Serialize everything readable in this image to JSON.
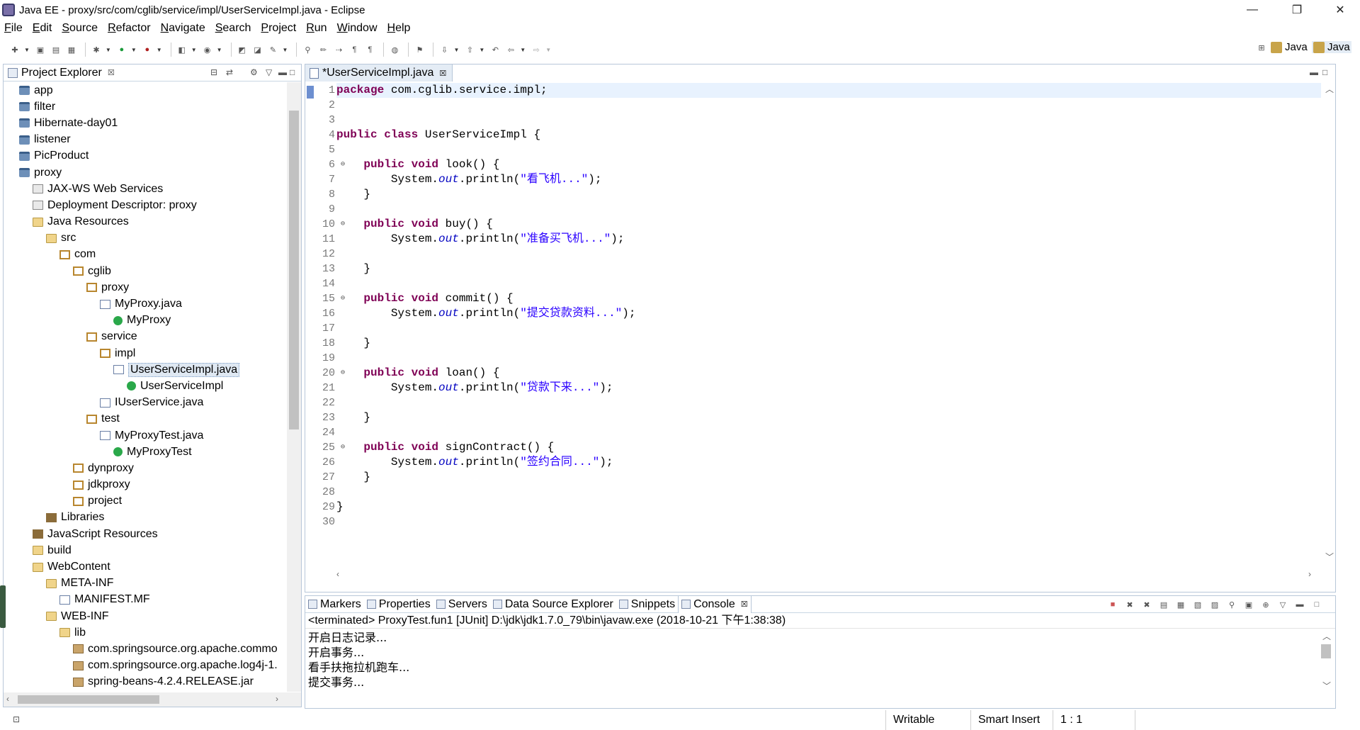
{
  "window": {
    "title": "Java EE - proxy/src/com/cglib/service/impl/UserServiceImpl.java - Eclipse",
    "minimize": "—",
    "restore": "❐",
    "close": "✕"
  },
  "menu": [
    "File",
    "Edit",
    "Source",
    "Refactor",
    "Navigate",
    "Search",
    "Project",
    "Run",
    "Window",
    "Help"
  ],
  "perspectives": [
    "Java",
    "Java"
  ],
  "explorer": {
    "tab_label": "Project Explorer",
    "close_glyph": "☒",
    "tree": [
      {
        "label": "app",
        "icon": "proj",
        "depth": 0
      },
      {
        "label": "filter",
        "icon": "proj",
        "depth": 0
      },
      {
        "label": "Hibernate-day01",
        "icon": "proj",
        "depth": 0
      },
      {
        "label": "listener",
        "icon": "proj",
        "depth": 0
      },
      {
        "label": "PicProduct",
        "icon": "proj",
        "depth": 0
      },
      {
        "label": "proxy",
        "icon": "proj",
        "depth": 0
      },
      {
        "label": "JAX-WS Web Services",
        "icon": "ws",
        "depth": 1
      },
      {
        "label": "Deployment Descriptor: proxy",
        "icon": "ws",
        "depth": 1
      },
      {
        "label": "Java Resources",
        "icon": "folder",
        "depth": 1
      },
      {
        "label": "src",
        "icon": "folder",
        "depth": 2
      },
      {
        "label": "com",
        "icon": "pkg",
        "depth": 3
      },
      {
        "label": "cglib",
        "icon": "pkg",
        "depth": 4
      },
      {
        "label": "proxy",
        "icon": "pkg",
        "depth": 5
      },
      {
        "label": "MyProxy.java",
        "icon": "java",
        "depth": 6
      },
      {
        "label": "MyProxy",
        "icon": "class",
        "depth": 7
      },
      {
        "label": "service",
        "icon": "pkg",
        "depth": 5
      },
      {
        "label": "impl",
        "icon": "pkg",
        "depth": 6
      },
      {
        "label": "UserServiceImpl.java",
        "icon": "java",
        "depth": 7,
        "selected": true
      },
      {
        "label": "UserServiceImpl",
        "icon": "class",
        "depth": 8
      },
      {
        "label": "IUserService.java",
        "icon": "java",
        "depth": 6
      },
      {
        "label": "test",
        "icon": "pkg",
        "depth": 5
      },
      {
        "label": "MyProxyTest.java",
        "icon": "java",
        "depth": 6
      },
      {
        "label": "MyProxyTest",
        "icon": "class",
        "depth": 7
      },
      {
        "label": "dynproxy",
        "icon": "pkg",
        "depth": 4
      },
      {
        "label": "jdkproxy",
        "icon": "pkg",
        "depth": 4
      },
      {
        "label": "project",
        "icon": "pkg",
        "depth": 4
      },
      {
        "label": "Libraries",
        "icon": "lib",
        "depth": 2
      },
      {
        "label": "JavaScript Resources",
        "icon": "lib",
        "depth": 1
      },
      {
        "label": "build",
        "icon": "folder",
        "depth": 1
      },
      {
        "label": "WebContent",
        "icon": "folder",
        "depth": 1
      },
      {
        "label": "META-INF",
        "icon": "folder",
        "depth": 2
      },
      {
        "label": "MANIFEST.MF",
        "icon": "java",
        "depth": 3
      },
      {
        "label": "WEB-INF",
        "icon": "folder",
        "depth": 2
      },
      {
        "label": "lib",
        "icon": "folder",
        "depth": 3
      },
      {
        "label": "com.springsource.org.apache.commo",
        "icon": "jar",
        "depth": 4
      },
      {
        "label": "com.springsource.org.apache.log4j-1.",
        "icon": "jar",
        "depth": 4
      },
      {
        "label": "spring-beans-4.2.4.RELEASE.jar",
        "icon": "jar",
        "depth": 4
      }
    ]
  },
  "editor": {
    "tab_label": "*UserServiceImpl.java",
    "close_glyph": "☒",
    "lines": [
      [
        {
          "t": "package",
          "c": "kw"
        },
        {
          "t": " com.cglib.service.impl;"
        }
      ],
      [],
      [],
      [
        {
          "t": "public",
          "c": "kw"
        },
        {
          "t": " "
        },
        {
          "t": "class",
          "c": "kw"
        },
        {
          "t": " UserServiceImpl {"
        }
      ],
      [],
      [
        {
          "t": "    "
        },
        {
          "t": "public",
          "c": "kw"
        },
        {
          "t": " "
        },
        {
          "t": "void",
          "c": "kw"
        },
        {
          "t": " look() {"
        }
      ],
      [
        {
          "t": "        System."
        },
        {
          "t": "out",
          "c": "fld"
        },
        {
          "t": ".println("
        },
        {
          "t": "\"看飞机...\"",
          "c": "str"
        },
        {
          "t": ");"
        }
      ],
      [
        {
          "t": "    }"
        }
      ],
      [],
      [
        {
          "t": "    "
        },
        {
          "t": "public",
          "c": "kw"
        },
        {
          "t": " "
        },
        {
          "t": "void",
          "c": "kw"
        },
        {
          "t": " buy() {"
        }
      ],
      [
        {
          "t": "        System."
        },
        {
          "t": "out",
          "c": "fld"
        },
        {
          "t": ".println("
        },
        {
          "t": "\"准备买飞机...\"",
          "c": "str"
        },
        {
          "t": ");"
        }
      ],
      [],
      [
        {
          "t": "    }"
        }
      ],
      [],
      [
        {
          "t": "    "
        },
        {
          "t": "public",
          "c": "kw"
        },
        {
          "t": " "
        },
        {
          "t": "void",
          "c": "kw"
        },
        {
          "t": " commit() {"
        }
      ],
      [
        {
          "t": "        System."
        },
        {
          "t": "out",
          "c": "fld"
        },
        {
          "t": ".println("
        },
        {
          "t": "\"提交贷款资料...\"",
          "c": "str"
        },
        {
          "t": ");"
        }
      ],
      [],
      [
        {
          "t": "    }"
        }
      ],
      [],
      [
        {
          "t": "    "
        },
        {
          "t": "public",
          "c": "kw"
        },
        {
          "t": " "
        },
        {
          "t": "void",
          "c": "kw"
        },
        {
          "t": " loan() {"
        }
      ],
      [
        {
          "t": "        System."
        },
        {
          "t": "out",
          "c": "fld"
        },
        {
          "t": ".println("
        },
        {
          "t": "\"贷款下来...\"",
          "c": "str"
        },
        {
          "t": ");"
        }
      ],
      [],
      [
        {
          "t": "    }"
        }
      ],
      [],
      [
        {
          "t": "    "
        },
        {
          "t": "public",
          "c": "kw"
        },
        {
          "t": " "
        },
        {
          "t": "void",
          "c": "kw"
        },
        {
          "t": " signContract() {"
        }
      ],
      [
        {
          "t": "        System."
        },
        {
          "t": "out",
          "c": "fld"
        },
        {
          "t": ".println("
        },
        {
          "t": "\"签约合同...\"",
          "c": "str"
        },
        {
          "t": ");"
        }
      ],
      [
        {
          "t": "    }"
        }
      ],
      [],
      [
        {
          "t": "}"
        }
      ],
      []
    ],
    "fold_lines": [
      6,
      10,
      15,
      20,
      25
    ]
  },
  "console": {
    "tabs": [
      "Markers",
      "Properties",
      "Servers",
      "Data Source Explorer",
      "Snippets",
      "Console"
    ],
    "active_tab": "Console",
    "close_glyph": "☒",
    "description": "<terminated> ProxyTest.fun1 [JUnit] D:\\jdk\\jdk1.7.0_79\\bin\\javaw.exe (2018-10-21 下午1:38:38)",
    "output": [
      "开启日志记录...",
      "开启事务...",
      "看手扶拖拉机跑车...",
      "提交事务..."
    ]
  },
  "status": {
    "writable": "Writable",
    "insert_mode": "Smart Insert",
    "position": "1 : 1"
  }
}
